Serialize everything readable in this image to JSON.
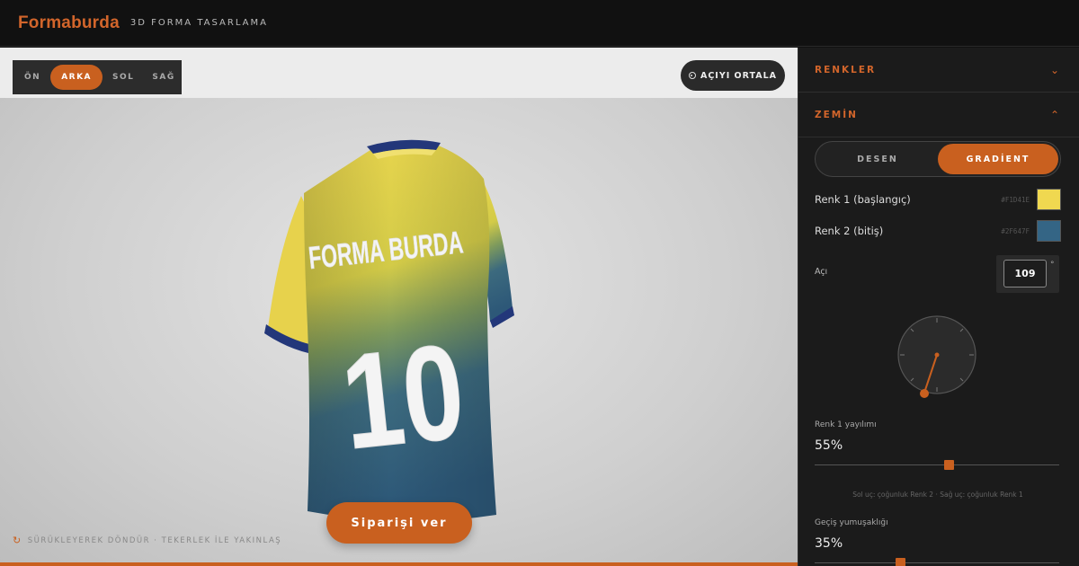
{
  "header": {
    "brand": "Formaburda",
    "subtitle": "3D FORMA TASARLAMA"
  },
  "viewer": {
    "tabs": [
      {
        "label": "ÖN",
        "active": false
      },
      {
        "label": "ARKA",
        "active": true
      },
      {
        "label": "SOL",
        "active": false
      },
      {
        "label": "SAĞ",
        "active": false
      }
    ],
    "center_button": "AÇIYI ORTALA",
    "order_button": "Siparişi ver",
    "hint": "SÜRÜKLEYEREK DÖNDÜR · TEKERLEK İLE YAKINLAŞ",
    "jersey": {
      "name_text": "FORMA BURDA",
      "number_text": "10"
    }
  },
  "panel": {
    "sections": {
      "colors": "RENKLER",
      "ground": "ZEMİN"
    },
    "segmented": {
      "option1": "DESEN",
      "option2": "GRADİENT",
      "selected": "GRADİENT"
    },
    "color1": {
      "label": "Renk 1 (başlangıç)",
      "hex": "#F1D41E",
      "swatch": "#f0d850"
    },
    "color2": {
      "label": "Renk 2 (bitiş)",
      "hex": "#2F647F",
      "swatch": "#346585"
    },
    "angle": {
      "label": "Açı",
      "value": "109",
      "unit": "°"
    },
    "spread": {
      "label": "Renk 1 yayılımı",
      "value": "55%",
      "fraction": 0.55
    },
    "note": "Sol uç: çoğunluk Renk 2 · Sağ uç: çoğunluk Renk 1",
    "softness": {
      "label": "Geçiş yumuşaklığı",
      "value": "35%",
      "fraction": 0.35
    }
  },
  "colors": {
    "accent": "#c9601f",
    "jersey_yellow": "#e8d24a",
    "jersey_blue": "#2d5878"
  }
}
